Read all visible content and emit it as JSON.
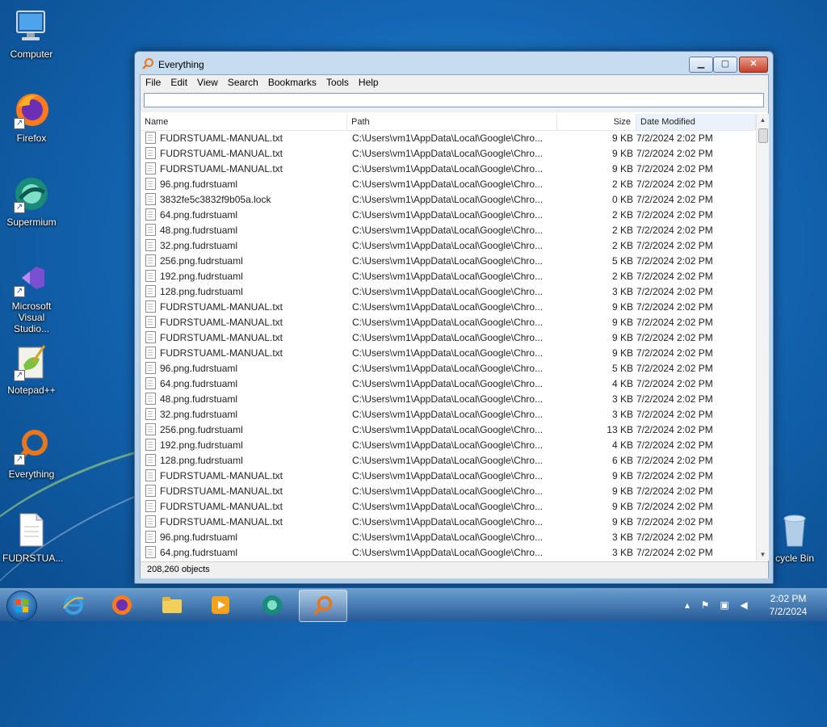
{
  "desktop": {
    "icons": [
      {
        "label": "Computer",
        "icon": "computer-icon"
      },
      {
        "label": "Firefox",
        "icon": "firefox-icon"
      },
      {
        "label": "Supermium",
        "icon": "supermium-icon"
      },
      {
        "label": "Microsoft Visual Studio...",
        "icon": "visual-studio-icon"
      },
      {
        "label": "Notepad++",
        "icon": "notepad-plus-plus-icon"
      },
      {
        "label": "Everything",
        "icon": "everything-icon"
      },
      {
        "label": "FUDRSTUA...",
        "icon": "text-file-icon"
      },
      {
        "label": "cycle Bin",
        "icon": "recycle-bin-icon"
      }
    ]
  },
  "window": {
    "title": "Everything",
    "menu": [
      "File",
      "Edit",
      "View",
      "Search",
      "Bookmarks",
      "Tools",
      "Help"
    ],
    "search": {
      "value": ""
    },
    "columns": {
      "name": "Name",
      "path": "Path",
      "size": "Size",
      "date": "Date Modified"
    },
    "sorted_column": "Date Modified",
    "rows": [
      {
        "name": "FUDRSTUAML-MANUAL.txt",
        "path": "C:\\Users\\vm1\\AppData\\Local\\Google\\Chro...",
        "size": "9 KB",
        "date": "7/2/2024 2:02 PM"
      },
      {
        "name": "FUDRSTUAML-MANUAL.txt",
        "path": "C:\\Users\\vm1\\AppData\\Local\\Google\\Chro...",
        "size": "9 KB",
        "date": "7/2/2024 2:02 PM"
      },
      {
        "name": "FUDRSTUAML-MANUAL.txt",
        "path": "C:\\Users\\vm1\\AppData\\Local\\Google\\Chro...",
        "size": "9 KB",
        "date": "7/2/2024 2:02 PM"
      },
      {
        "name": "96.png.fudrstuaml",
        "path": "C:\\Users\\vm1\\AppData\\Local\\Google\\Chro...",
        "size": "2 KB",
        "date": "7/2/2024 2:02 PM"
      },
      {
        "name": "3832fe5c3832f9b05a.lock",
        "path": "C:\\Users\\vm1\\AppData\\Local\\Google\\Chro...",
        "size": "0 KB",
        "date": "7/2/2024 2:02 PM"
      },
      {
        "name": "64.png.fudrstuaml",
        "path": "C:\\Users\\vm1\\AppData\\Local\\Google\\Chro...",
        "size": "2 KB",
        "date": "7/2/2024 2:02 PM"
      },
      {
        "name": "48.png.fudrstuaml",
        "path": "C:\\Users\\vm1\\AppData\\Local\\Google\\Chro...",
        "size": "2 KB",
        "date": "7/2/2024 2:02 PM"
      },
      {
        "name": "32.png.fudrstuaml",
        "path": "C:\\Users\\vm1\\AppData\\Local\\Google\\Chro...",
        "size": "2 KB",
        "date": "7/2/2024 2:02 PM"
      },
      {
        "name": "256.png.fudrstuaml",
        "path": "C:\\Users\\vm1\\AppData\\Local\\Google\\Chro...",
        "size": "5 KB",
        "date": "7/2/2024 2:02 PM"
      },
      {
        "name": "192.png.fudrstuaml",
        "path": "C:\\Users\\vm1\\AppData\\Local\\Google\\Chro...",
        "size": "2 KB",
        "date": "7/2/2024 2:02 PM"
      },
      {
        "name": "128.png.fudrstuaml",
        "path": "C:\\Users\\vm1\\AppData\\Local\\Google\\Chro...",
        "size": "3 KB",
        "date": "7/2/2024 2:02 PM"
      },
      {
        "name": "FUDRSTUAML-MANUAL.txt",
        "path": "C:\\Users\\vm1\\AppData\\Local\\Google\\Chro...",
        "size": "9 KB",
        "date": "7/2/2024 2:02 PM"
      },
      {
        "name": "FUDRSTUAML-MANUAL.txt",
        "path": "C:\\Users\\vm1\\AppData\\Local\\Google\\Chro...",
        "size": "9 KB",
        "date": "7/2/2024 2:02 PM"
      },
      {
        "name": "FUDRSTUAML-MANUAL.txt",
        "path": "C:\\Users\\vm1\\AppData\\Local\\Google\\Chro...",
        "size": "9 KB",
        "date": "7/2/2024 2:02 PM"
      },
      {
        "name": "FUDRSTUAML-MANUAL.txt",
        "path": "C:\\Users\\vm1\\AppData\\Local\\Google\\Chro...",
        "size": "9 KB",
        "date": "7/2/2024 2:02 PM"
      },
      {
        "name": "96.png.fudrstuaml",
        "path": "C:\\Users\\vm1\\AppData\\Local\\Google\\Chro...",
        "size": "5 KB",
        "date": "7/2/2024 2:02 PM"
      },
      {
        "name": "64.png.fudrstuaml",
        "path": "C:\\Users\\vm1\\AppData\\Local\\Google\\Chro...",
        "size": "4 KB",
        "date": "7/2/2024 2:02 PM"
      },
      {
        "name": "48.png.fudrstuaml",
        "path": "C:\\Users\\vm1\\AppData\\Local\\Google\\Chro...",
        "size": "3 KB",
        "date": "7/2/2024 2:02 PM"
      },
      {
        "name": "32.png.fudrstuaml",
        "path": "C:\\Users\\vm1\\AppData\\Local\\Google\\Chro...",
        "size": "3 KB",
        "date": "7/2/2024 2:02 PM"
      },
      {
        "name": "256.png.fudrstuaml",
        "path": "C:\\Users\\vm1\\AppData\\Local\\Google\\Chro...",
        "size": "13 KB",
        "date": "7/2/2024 2:02 PM"
      },
      {
        "name": "192.png.fudrstuaml",
        "path": "C:\\Users\\vm1\\AppData\\Local\\Google\\Chro...",
        "size": "4 KB",
        "date": "7/2/2024 2:02 PM"
      },
      {
        "name": "128.png.fudrstuaml",
        "path": "C:\\Users\\vm1\\AppData\\Local\\Google\\Chro...",
        "size": "6 KB",
        "date": "7/2/2024 2:02 PM"
      },
      {
        "name": "FUDRSTUAML-MANUAL.txt",
        "path": "C:\\Users\\vm1\\AppData\\Local\\Google\\Chro...",
        "size": "9 KB",
        "date": "7/2/2024 2:02 PM"
      },
      {
        "name": "FUDRSTUAML-MANUAL.txt",
        "path": "C:\\Users\\vm1\\AppData\\Local\\Google\\Chro...",
        "size": "9 KB",
        "date": "7/2/2024 2:02 PM"
      },
      {
        "name": "FUDRSTUAML-MANUAL.txt",
        "path": "C:\\Users\\vm1\\AppData\\Local\\Google\\Chro...",
        "size": "9 KB",
        "date": "7/2/2024 2:02 PM"
      },
      {
        "name": "FUDRSTUAML-MANUAL.txt",
        "path": "C:\\Users\\vm1\\AppData\\Local\\Google\\Chro...",
        "size": "9 KB",
        "date": "7/2/2024 2:02 PM"
      },
      {
        "name": "96.png.fudrstuaml",
        "path": "C:\\Users\\vm1\\AppData\\Local\\Google\\Chro...",
        "size": "3 KB",
        "date": "7/2/2024 2:02 PM"
      },
      {
        "name": "64.png.fudrstuaml",
        "path": "C:\\Users\\vm1\\AppData\\Local\\Google\\Chro...",
        "size": "3 KB",
        "date": "7/2/2024 2:02 PM"
      }
    ],
    "status": "208,260 objects"
  },
  "taskbar": {
    "apps": [
      {
        "icon": "internet-explorer-icon",
        "active": false
      },
      {
        "icon": "firefox-icon",
        "active": false
      },
      {
        "icon": "file-explorer-icon",
        "active": false
      },
      {
        "icon": "media-player-icon",
        "active": false
      },
      {
        "icon": "supermium-icon",
        "active": false
      },
      {
        "icon": "everything-icon",
        "active": true
      }
    ],
    "clock": {
      "time": "2:02 PM",
      "date": "7/2/2024"
    }
  },
  "colors": {
    "window_frame": "#b3cde8",
    "sorted_header": "#eaf3fc",
    "everything_orange": "#e8761d",
    "close_button": "#c7402a"
  }
}
